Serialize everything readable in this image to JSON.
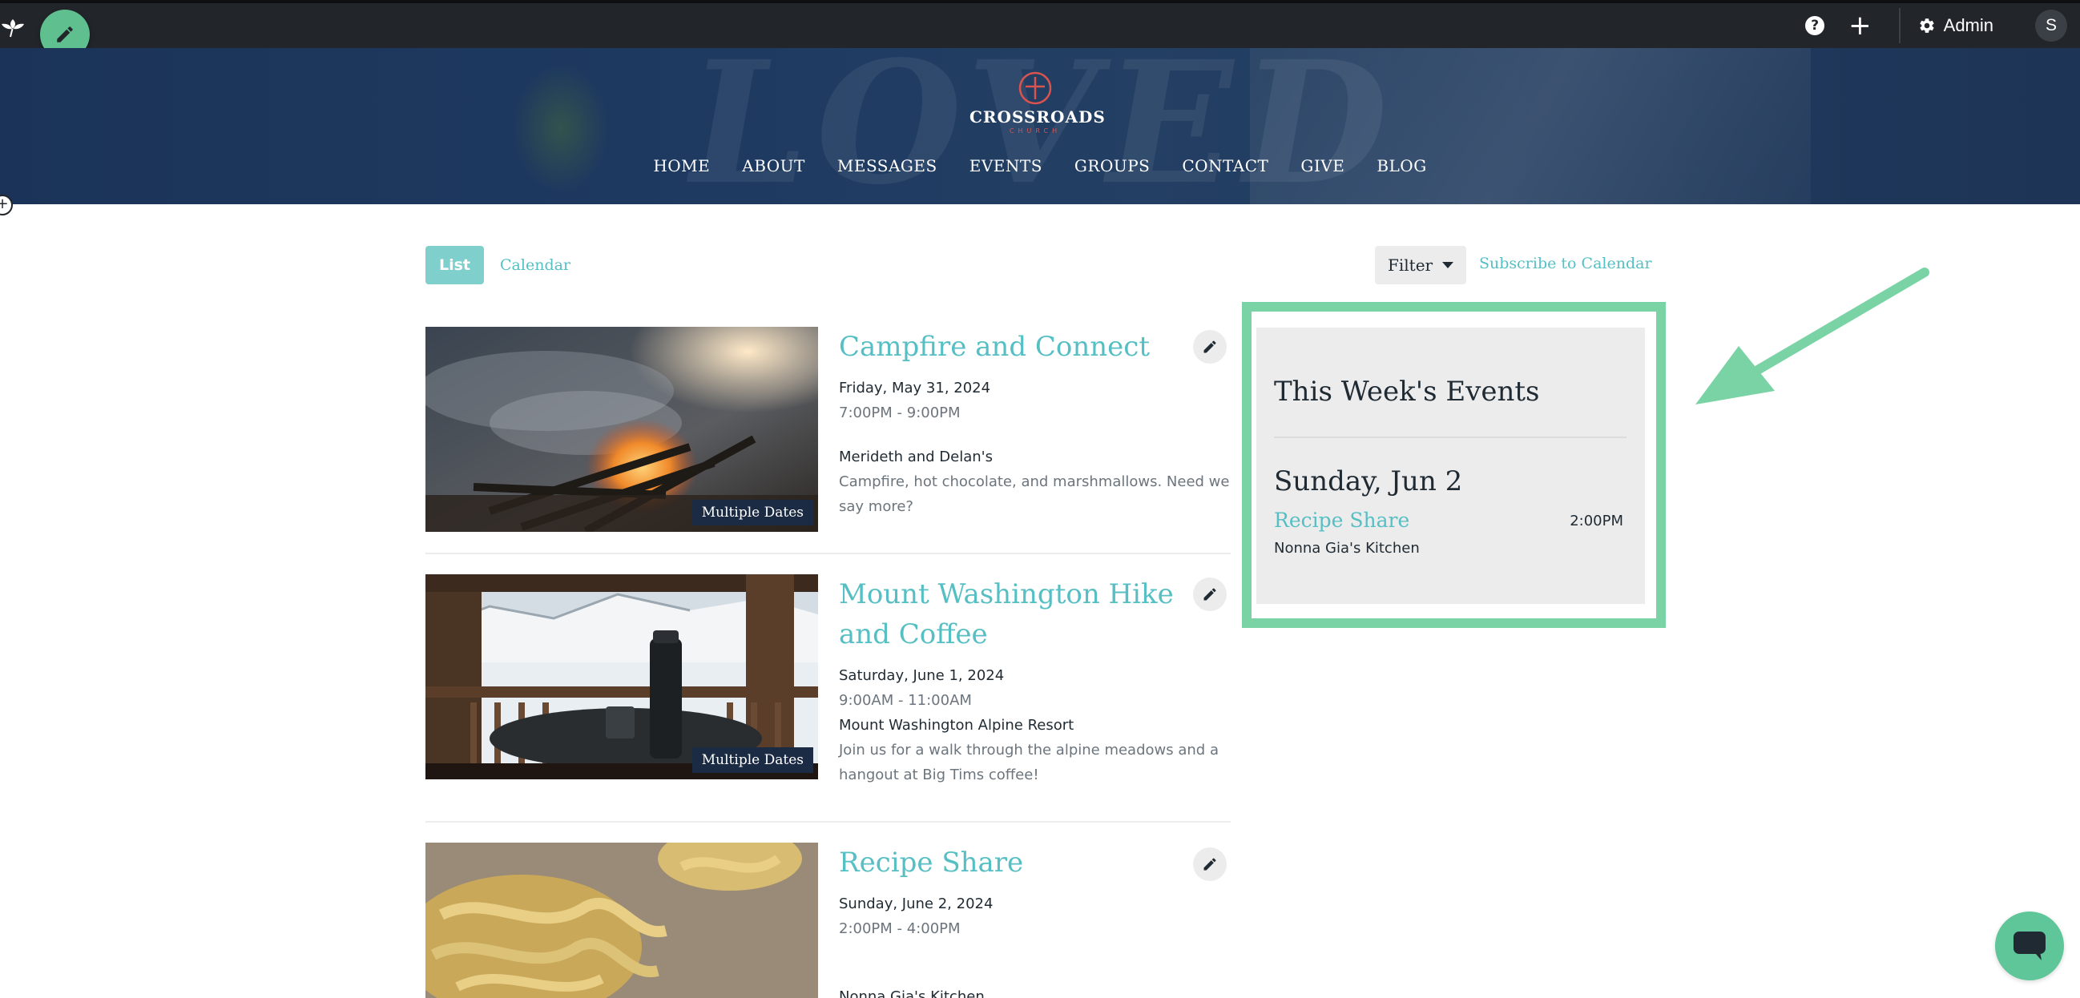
{
  "admin_bar": {
    "admin_label": "Admin",
    "avatar_initial": "S",
    "help_symbol": "?",
    "add_symbol": "+"
  },
  "site": {
    "logo_name": "CROSSROADS",
    "logo_sub": "CHURCH"
  },
  "nav": {
    "items": [
      "HOME",
      "ABOUT",
      "MESSAGES",
      "EVENTS",
      "GROUPS",
      "CONTACT",
      "GIVE",
      "BLOG"
    ]
  },
  "toolbar": {
    "list_label": "List",
    "calendar_label": "Calendar",
    "filter_label": "Filter",
    "subscribe_label": "Subscribe to Calendar"
  },
  "events": [
    {
      "title": "Campfire and Connect",
      "date": "Friday, May 31, 2024",
      "time": "7:00PM - 9:00PM",
      "location": "Merideth and Delan's",
      "description": "Campfire, hot chocolate, and marshmallows. Need we say more?",
      "badge": "Multiple Dates"
    },
    {
      "title": "Mount Washington Hike and Coffee",
      "date": "Saturday, June 1, 2024",
      "time": "9:00AM - 11:00AM",
      "location": "Mount Washington Alpine Resort",
      "description": "Join us for a walk through the alpine meadows and a hangout at Big Tims coffee!",
      "badge": "Multiple Dates"
    },
    {
      "title": "Recipe Share",
      "date": "Sunday, June 2, 2024",
      "time": "2:00PM - 4:00PM",
      "location": "Nonna Gia's Kitchen"
    }
  ],
  "week_widget": {
    "title": "This Week's Events",
    "day": "Sunday, Jun 2",
    "event_title": "Recipe Share",
    "event_time": "2:00PM",
    "event_location": "Nonna Gia's Kitchen"
  },
  "colors": {
    "accent_teal": "#56bfc4",
    "highlight_green": "#79d3a4",
    "admin_bar": "#22262b",
    "hero_navy": "#1e3a61"
  }
}
